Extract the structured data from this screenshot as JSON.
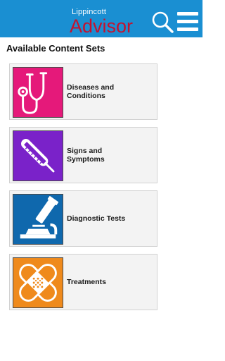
{
  "header": {
    "logo_small": "Lippincott",
    "logo_large": "Advisor",
    "background": "#1a8fd2",
    "logo_color": "#c4122f",
    "icons": [
      "search-icon",
      "menu-icon"
    ]
  },
  "main": {
    "title": "Available Content Sets",
    "items": [
      {
        "label_line1": "Diseases and",
        "label_line2": "Conditions",
        "icon": "stethoscope-icon",
        "color": "#e5197a"
      },
      {
        "label_line1": "Signs and",
        "label_line2": "Symptoms",
        "icon": "thermometer-icon",
        "color": "#7a22c9"
      },
      {
        "label_line1": "Diagnostic Tests",
        "label_line2": "",
        "icon": "microscope-icon",
        "color": "#0f68ad"
      },
      {
        "label_line1": "Treatments",
        "label_line2": "",
        "icon": "bandage-icon",
        "color": "#ef8a1c"
      }
    ]
  }
}
